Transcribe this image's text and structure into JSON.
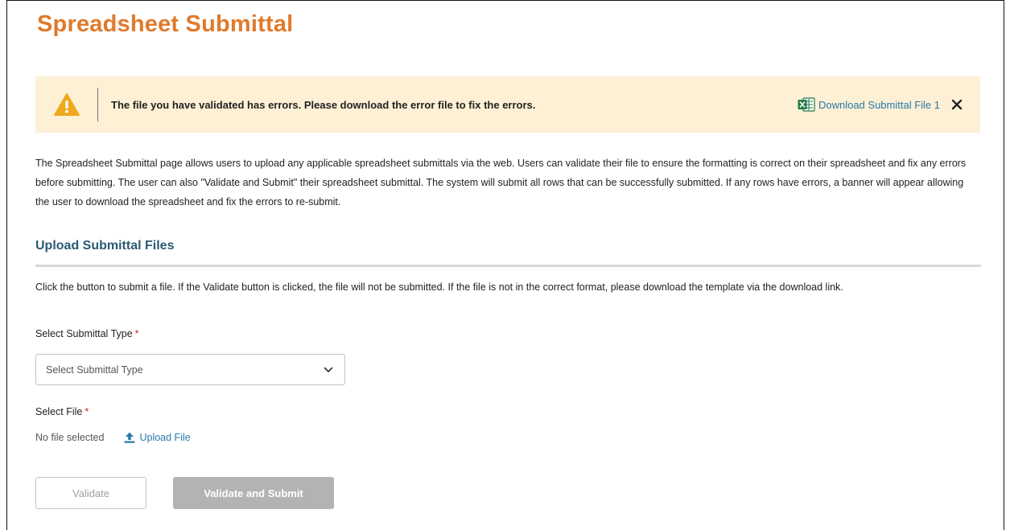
{
  "page": {
    "title": "Spreadsheet Submittal"
  },
  "banner": {
    "icon": "warning-icon",
    "message": "The file you have validated has errors. Please download the error file to fix the errors.",
    "download_label": "Download Submittal File 1",
    "download_icon": "excel-file-icon",
    "close_icon": "close-icon",
    "background_color": "#fdf0d5",
    "icon_color": "#f0a81c"
  },
  "intro": {
    "text": "The Spreadsheet Submittal page allows users to upload any applicable spreadsheet submittals via the web. Users can validate their file to ensure the formatting is correct on their spreadsheet and fix any errors before submitting. The user can also \"Validate and Submit\" their spreadsheet submittal. The system will submit all rows that can be successfully submitted. If any rows have errors, a banner will appear allowing the user to download the spreadsheet and fix the errors to re-submit."
  },
  "upload_section": {
    "title": "Upload Submittal Files",
    "instructions": "Click the button to submit a file. If the Validate button is clicked, the file will not be submitted. If the file is not in the correct format, please download the template via the download link.",
    "submittal_type": {
      "label": "Select Submittal Type",
      "required_mark": "*",
      "placeholder": "Select Submittal Type"
    },
    "file": {
      "label": "Select File",
      "required_mark": "*",
      "status": "No file selected",
      "upload_label": "Upload File"
    },
    "buttons": {
      "validate_label": "Validate",
      "validate_submit_label": "Validate and Submit"
    }
  },
  "colors": {
    "title": "#e07a2b",
    "section_title": "#2b5a73",
    "link": "#2a7aaa",
    "required": "#cc2222",
    "disabled_button": "#b3b3b3"
  }
}
